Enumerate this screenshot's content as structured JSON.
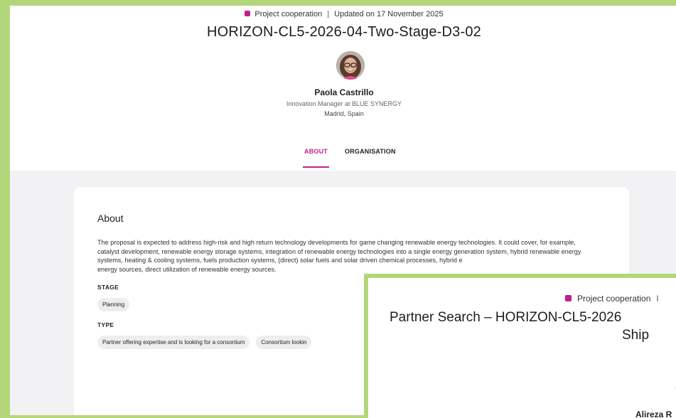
{
  "main_window": {
    "category": "Project cooperation",
    "separator": "|",
    "updated": "Updated on 17 November 2025",
    "title": "HORIZON-CL5-2026-04-Two-Stage-D3-02",
    "person": {
      "name": "Paola Castrillo",
      "role": "Innovation Manager at BLUE SYNERGY",
      "location": "Madrid, Spain"
    },
    "tabs": [
      {
        "label": "ABOUT",
        "active": true
      },
      {
        "label": "ORGANISATION",
        "active": false
      }
    ],
    "about": {
      "heading": "About",
      "text": "The proposal is expected to address high-risk and high return technology developments for game changing renewable energy technologies. It could cover, for example, catalyst development, renewable energy storage systems, integration of renewable energy technologies into a single energy generation system, hybrid renewable energy systems, heating & cooling systems, fuels production systems, (direct) solar fuels and solar driven chemical processes, hybrid e",
      "text_end": "energy sources, direct utilization of renewable energy sources.",
      "stage_label": "STAGE",
      "stage_chips": [
        "Planning"
      ],
      "type_label": "TYPE",
      "type_chips": [
        "Partner offering expertise and is looking for a consortium",
        "Consortium lookin"
      ]
    }
  },
  "overlay_window": {
    "category": "Project cooperation",
    "separator": "I",
    "title_line1": "Partner Search – HORIZON-CL5-2026",
    "title_line2": "Ship",
    "fragment": "(",
    "person_name_fragment": "Alireza R"
  },
  "colors": {
    "accent": "#c21f8e",
    "frame": "#b3d67a",
    "page_bg": "#f2f1f3"
  }
}
